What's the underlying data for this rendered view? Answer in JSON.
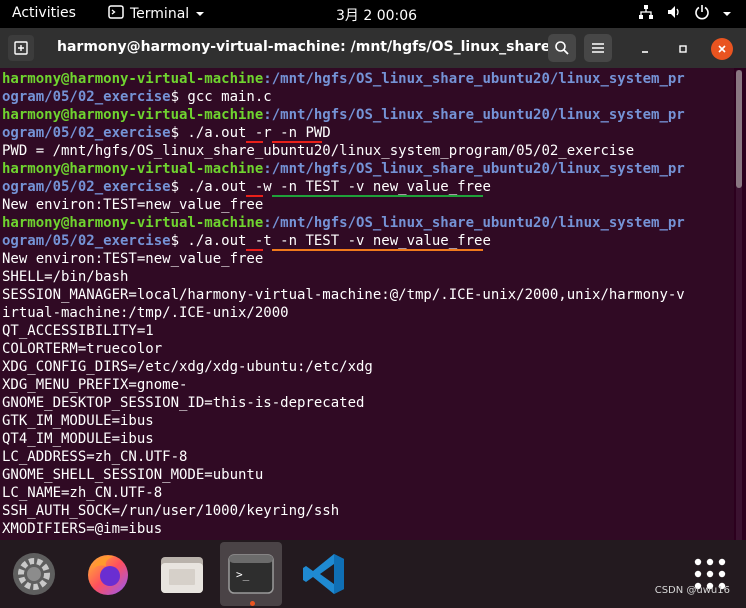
{
  "topbar": {
    "activities": "Activities",
    "app_name": "Terminal",
    "clock": "3月 2  00:06"
  },
  "titlebar": {
    "title": "harmony@harmony-virtual-machine: /mnt/hgfs/OS_linux_share_..."
  },
  "terminal": {
    "user_host": "harmony@harmony-virtual-machine",
    "lines": [
      {
        "type": "prompt",
        "user": "harmony@harmony-virtual-machine",
        "path": ":/mnt/hgfs/OS_linux_share_ubuntu20/linux_system_pr"
      },
      {
        "type": "promptcont",
        "path": "ogram/05/02_exercise",
        "tail": "$ gcc main.c"
      },
      {
        "type": "prompt",
        "user": "harmony@harmony-virtual-machine",
        "path": ":/mnt/hgfs/OS_linux_share_ubuntu20/linux_system_pr"
      },
      {
        "type": "promptcont",
        "path": "ogram/05/02_exercise",
        "tail": "$ ./a.out -r -n PWD"
      },
      {
        "type": "out",
        "text": "PWD = /mnt/hgfs/OS_linux_share_ubuntu20/linux_system_program/05/02_exercise"
      },
      {
        "type": "prompt",
        "user": "harmony@harmony-virtual-machine",
        "path": ":/mnt/hgfs/OS_linux_share_ubuntu20/linux_system_pr"
      },
      {
        "type": "promptcont",
        "path": "ogram/05/02_exercise",
        "tail": "$ ./a.out -w -n TEST -v new_value_free"
      },
      {
        "type": "out",
        "text": "New environ:TEST=new_value_free"
      },
      {
        "type": "prompt",
        "user": "harmony@harmony-virtual-machine",
        "path": ":/mnt/hgfs/OS_linux_share_ubuntu20/linux_system_pr"
      },
      {
        "type": "promptcont",
        "path": "ogram/05/02_exercise",
        "tail": "$ ./a.out -t -n TEST -v new_value_free"
      },
      {
        "type": "out",
        "text": "New environ:TEST=new_value_free"
      },
      {
        "type": "out",
        "text": "SHELL=/bin/bash"
      },
      {
        "type": "out",
        "text": "SESSION_MANAGER=local/harmony-virtual-machine:@/tmp/.ICE-unix/2000,unix/harmony-v"
      },
      {
        "type": "out",
        "text": "irtual-machine:/tmp/.ICE-unix/2000"
      },
      {
        "type": "out",
        "text": "QT_ACCESSIBILITY=1"
      },
      {
        "type": "out",
        "text": "COLORTERM=truecolor"
      },
      {
        "type": "out",
        "text": "XDG_CONFIG_DIRS=/etc/xdg/xdg-ubuntu:/etc/xdg"
      },
      {
        "type": "out",
        "text": "XDG_MENU_PREFIX=gnome-"
      },
      {
        "type": "out",
        "text": "GNOME_DESKTOP_SESSION_ID=this-is-deprecated"
      },
      {
        "type": "out",
        "text": "GTK_IM_MODULE=ibus"
      },
      {
        "type": "out",
        "text": "QT4_IM_MODULE=ibus"
      },
      {
        "type": "out",
        "text": "LC_ADDRESS=zh_CN.UTF-8"
      },
      {
        "type": "out",
        "text": "GNOME_SHELL_SESSION_MODE=ubuntu"
      },
      {
        "type": "out",
        "text": "LC_NAME=zh_CN.UTF-8"
      },
      {
        "type": "out",
        "text": "SSH_AUTH_SOCK=/run/user/1000/keyring/ssh"
      },
      {
        "type": "out",
        "text": "XMODIFIERS=@im=ibus"
      }
    ]
  },
  "annotations": {
    "red": "#e8201a",
    "green": "#1fa13a",
    "orange": "#f07a1c"
  },
  "dock": {
    "items": [
      "settings-icon",
      "firefox-icon",
      "files-icon",
      "terminal-icon",
      "vscode-icon",
      "app-grid-icon"
    ]
  },
  "watermark": "CSDN @uwu16"
}
